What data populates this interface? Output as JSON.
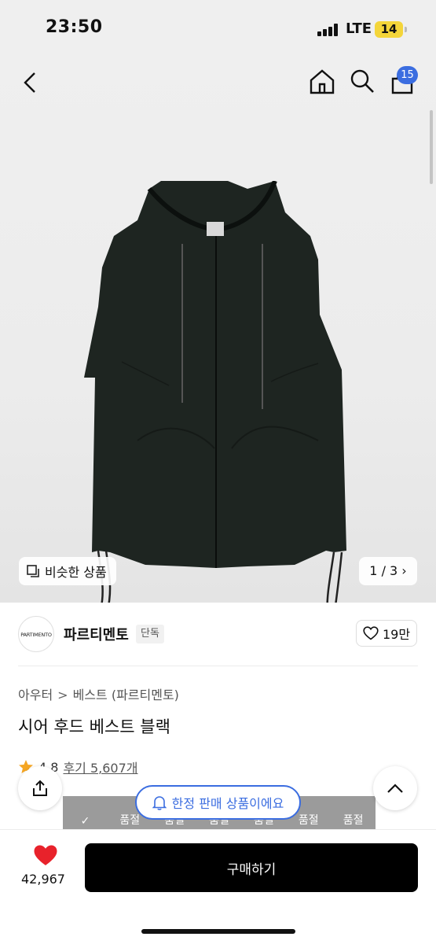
{
  "status_bar": {
    "time": "23:50",
    "network": "LTE",
    "battery": "14"
  },
  "header": {
    "cart_count": "15"
  },
  "product_image": {
    "similar_label": "비슷한 상품",
    "pager": "1 / 3 ›"
  },
  "brand": {
    "logo_text": "PARTIMENTO",
    "name": "파르티멘토",
    "tag": "단독",
    "likes": "19만"
  },
  "breadcrumb": {
    "category": "아우터",
    "subcategory": "베스트 (파르티멘토)"
  },
  "product": {
    "title": "시어 후드 베스트 블랙",
    "rating": "4.8",
    "reviews": "후기 5,607개"
  },
  "size_bar": {
    "options": [
      "✓",
      "품절",
      "품절",
      "품절",
      "품절",
      "품절",
      "품절"
    ]
  },
  "notice": {
    "limited_label": "한정 판매 상품이에요"
  },
  "bottom": {
    "wish_count": "42,967",
    "buy_label": "구매하기"
  },
  "colors": {
    "accent": "#3b6de0",
    "heart": "#e8222b",
    "star": "#f5a623"
  }
}
